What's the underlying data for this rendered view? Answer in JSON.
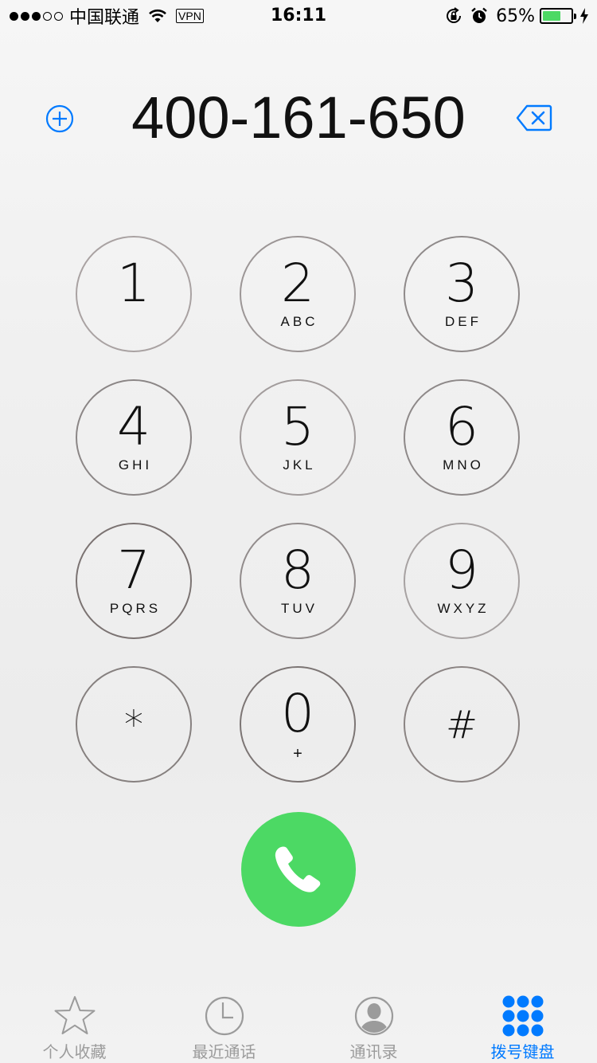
{
  "status_bar": {
    "signal_full": 3,
    "signal_empty": 2,
    "carrier": "中国联通",
    "vpn": "VPN",
    "time": "16:11",
    "battery_percent": "65%",
    "battery_level": 0.65,
    "icons": [
      "wifi-icon",
      "rotation-lock-icon",
      "alarm-icon",
      "charging-icon"
    ]
  },
  "dialer": {
    "number": "400-161-650"
  },
  "keys": [
    {
      "digit": "1",
      "letters": ""
    },
    {
      "digit": "2",
      "letters": "ABC"
    },
    {
      "digit": "3",
      "letters": "DEF"
    },
    {
      "digit": "4",
      "letters": "GHI"
    },
    {
      "digit": "5",
      "letters": "JKL"
    },
    {
      "digit": "6",
      "letters": "MNO"
    },
    {
      "digit": "7",
      "letters": "PQRS"
    },
    {
      "digit": "8",
      "letters": "TUV"
    },
    {
      "digit": "9",
      "letters": "WXYZ"
    },
    {
      "digit": "*",
      "letters": ""
    },
    {
      "digit": "0",
      "letters": "+"
    },
    {
      "digit": "#",
      "letters": ""
    }
  ],
  "tabs": [
    {
      "label": "个人收藏",
      "icon": "star-icon",
      "active": false
    },
    {
      "label": "最近通话",
      "icon": "clock-icon",
      "active": false
    },
    {
      "label": "通讯录",
      "icon": "contacts-icon",
      "active": false
    },
    {
      "label": "拨号键盘",
      "icon": "keypad-icon",
      "active": true
    }
  ],
  "colors": {
    "accent": "#007aff",
    "call_green": "#4cd964",
    "battery_green": "#4cd964",
    "inactive_tab": "#9b9b9b"
  }
}
